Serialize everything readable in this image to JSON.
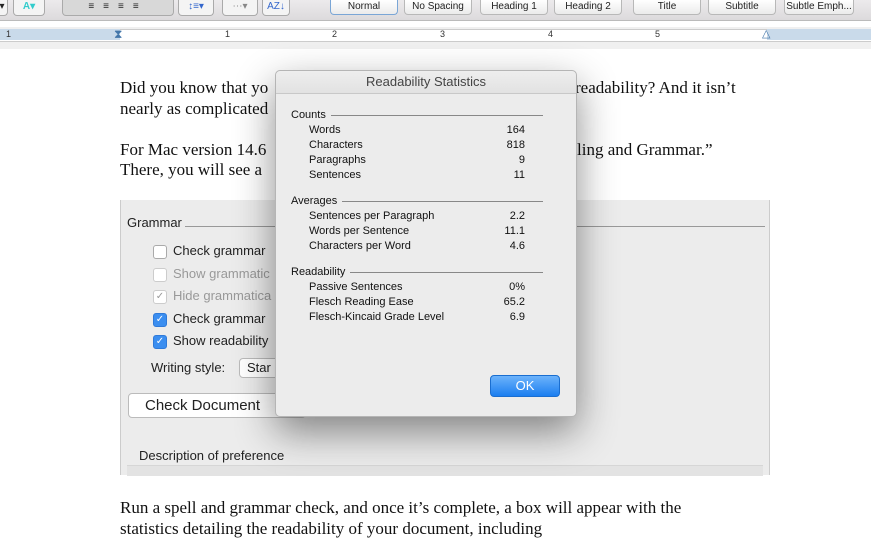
{
  "toolbar": {
    "styles": [
      "Normal",
      "No Spacing",
      "Heading 1",
      "Heading 2",
      "Title",
      "Subtitle",
      "Subtle Emph..."
    ],
    "icons": [
      "text-effects-icon",
      "align-left-icon",
      "align-center-icon",
      "align-right-icon",
      "justify-icon",
      "line-spacing-icon",
      "borders-icon",
      "sort-icon"
    ]
  },
  "ruler": {
    "labels": [
      "1",
      "1",
      "2",
      "3",
      "4",
      "5"
    ]
  },
  "document": {
    "p1_line1_left": "Did you know that yo",
    "p1_line1_right": "readability? And it isn’t",
    "p1_line2_left": "nearly as complicated",
    "p2_line1_left": "For Mac version 14.6",
    "p2_line1_right": "ling and Grammar.”",
    "p2_line2_left": "There, you will see a",
    "p3_line1": "Run a spell and grammar check, and once it’s complete, a box will appear with the",
    "p3_line2": "statistics detailing the readability of your document, including"
  },
  "grammar_panel": {
    "heading": "Grammar",
    "options": [
      {
        "label": "Check grammar",
        "checked": false,
        "disabled": false
      },
      {
        "label": "Show grammatic",
        "checked": false,
        "disabled": true
      },
      {
        "label": "Hide grammatica",
        "checked": true,
        "disabled": true
      },
      {
        "label": "Check grammar",
        "checked": true,
        "disabled": false
      },
      {
        "label": "Show readability",
        "checked": true,
        "disabled": false
      }
    ],
    "writing_style_label": "Writing style:",
    "writing_style_value": "Star",
    "check_document": "Check Document",
    "description_label": "Description of preference"
  },
  "dialog": {
    "title": "Readability Statistics",
    "counts": {
      "heading": "Counts",
      "rows": [
        [
          "Words",
          "164"
        ],
        [
          "Characters",
          "818"
        ],
        [
          "Paragraphs",
          "9"
        ],
        [
          "Sentences",
          "11"
        ]
      ]
    },
    "averages": {
      "heading": "Averages",
      "rows": [
        [
          "Sentences per Paragraph",
          "2.2"
        ],
        [
          "Words per Sentence",
          "11.1"
        ],
        [
          "Characters per Word",
          "4.6"
        ]
      ]
    },
    "readability": {
      "heading": "Readability",
      "rows": [
        [
          "Passive Sentences",
          "0%"
        ],
        [
          "Flesch Reading Ease",
          "65.2"
        ],
        [
          "Flesch-Kincaid Grade Level",
          "6.9"
        ]
      ]
    },
    "ok": "OK"
  },
  "colors": {
    "accent": "#1b7ef0"
  }
}
